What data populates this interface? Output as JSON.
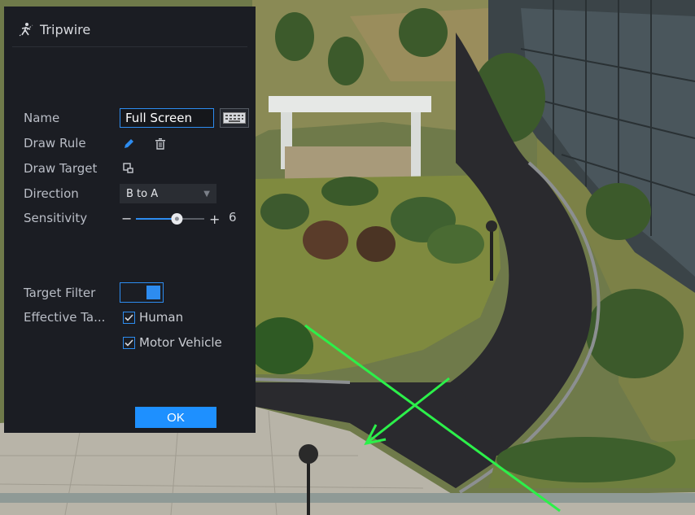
{
  "panel": {
    "title": "Tripwire",
    "title_icon": "tripwire-person-icon"
  },
  "form": {
    "name_label": "Name",
    "name_value": "Full Screen",
    "draw_rule_label": "Draw Rule",
    "draw_target_label": "Draw Target",
    "direction_label": "Direction",
    "direction_value": "B to A",
    "sensitivity_label": "Sensitivity",
    "sensitivity_value": "6",
    "sensitivity_minus": "−",
    "sensitivity_plus": "+",
    "target_filter_label": "Target Filter",
    "target_filter_on": true,
    "effective_target_label": "Effective Ta...",
    "targets": [
      {
        "label": "Human",
        "checked": true
      },
      {
        "label": "Motor Vehicle",
        "checked": true
      }
    ]
  },
  "actions": {
    "ok_label": "OK"
  },
  "colors": {
    "accent": "#2d8cf0",
    "ok_button": "#1e90ff",
    "panel_bg": "#1b1d23",
    "tripwire_line": "#2cf04a"
  },
  "icons": [
    "keyboard-icon",
    "pencil-icon",
    "trash-icon",
    "draw-target-icon",
    "check-icon"
  ]
}
